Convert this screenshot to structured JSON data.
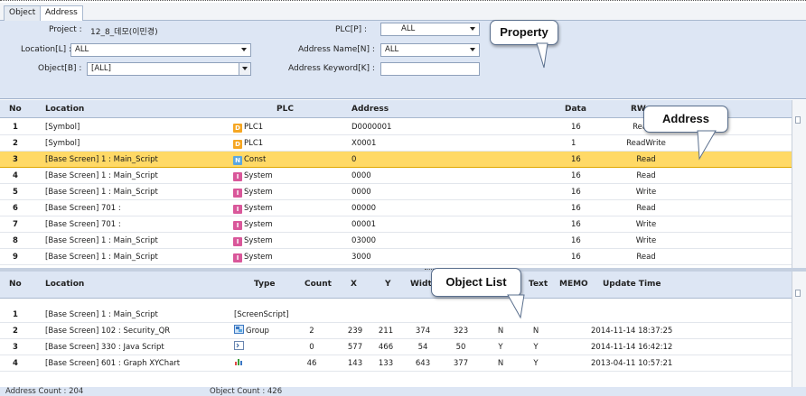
{
  "tabs": [
    "Object",
    "Address"
  ],
  "property": {
    "project_label": "Project :",
    "project_value": "12_8_데모(이민경)",
    "location_label": "Location[L] :",
    "location_value": "ALL",
    "object_label": "Object[B] :",
    "object_value": "[ALL]",
    "plc_label": "PLC[P] :",
    "plc_value": "ALL",
    "address_name_label": "Address Name[N] :",
    "address_name_value": "ALL",
    "address_keyword_label": "Address Keyword[K] :",
    "address_keyword_value": ""
  },
  "address_table": {
    "columns": [
      "No",
      "Location",
      "PLC",
      "Address",
      "Data",
      "RW"
    ],
    "rows": [
      {
        "no": "1",
        "location": "[Symbol]",
        "plc_icon": "D",
        "plc_color": "#f5a623",
        "plc": "PLC1",
        "address": "D0000001",
        "data": "16",
        "rw": "ReadW"
      },
      {
        "no": "2",
        "location": "[Symbol]",
        "plc_icon": "D",
        "plc_color": "#f5a623",
        "plc": "PLC1",
        "address": "X0001",
        "data": "1",
        "rw": "ReadWrite"
      },
      {
        "no": "3",
        "location": "[Base Screen] 1 : Main_Script",
        "plc_icon": "N",
        "plc_color": "#5aa7e0",
        "plc": "Const",
        "address": "0",
        "data": "16",
        "rw": "Read"
      },
      {
        "no": "4",
        "location": "[Base Screen] 1 : Main_Script",
        "plc_icon": "I",
        "plc_color": "#d9579a",
        "plc": "System",
        "address": "0000",
        "data": "16",
        "rw": "Read"
      },
      {
        "no": "5",
        "location": "[Base Screen] 1 : Main_Script",
        "plc_icon": "I",
        "plc_color": "#d9579a",
        "plc": "System",
        "address": "0000",
        "data": "16",
        "rw": "Write"
      },
      {
        "no": "6",
        "location": "[Base Screen] 701 :",
        "plc_icon": "I",
        "plc_color": "#d9579a",
        "plc": "System",
        "address": "00000",
        "data": "16",
        "rw": "Read"
      },
      {
        "no": "7",
        "location": "[Base Screen] 701 :",
        "plc_icon": "I",
        "plc_color": "#d9579a",
        "plc": "System",
        "address": "00001",
        "data": "16",
        "rw": "Write"
      },
      {
        "no": "8",
        "location": "[Base Screen] 1 : Main_Script",
        "plc_icon": "I",
        "plc_color": "#d9579a",
        "plc": "System",
        "address": "03000",
        "data": "16",
        "rw": "Write"
      },
      {
        "no": "9",
        "location": "[Base Screen] 1 : Main_Script",
        "plc_icon": "I",
        "plc_color": "#d9579a",
        "plc": "System",
        "address": "3000",
        "data": "16",
        "rw": "Read"
      }
    ]
  },
  "object_table": {
    "columns": [
      "No",
      "Location",
      "Type",
      "Count",
      "X",
      "Y",
      "Widt",
      "",
      "",
      "Text",
      "MEMO",
      "Update Time"
    ],
    "rows": [
      {
        "no": "1",
        "location": "[Base Screen] 1 : Main_Script",
        "type": "[ScreenScript]",
        "type_icon": "",
        "count": "",
        "x": "",
        "y": "",
        "w": "",
        "h": "",
        "c1": "",
        "text": "",
        "memo": "",
        "time": ""
      },
      {
        "no": "2",
        "location": "[Base Screen] 102 : Security_QR",
        "type": "Group",
        "type_icon": "group-icon",
        "count": "2",
        "x": "239",
        "y": "211",
        "w": "374",
        "h": "323",
        "c1": "N",
        "text": "N",
        "memo": "",
        "time": "2014-11-14 18:37:25"
      },
      {
        "no": "3",
        "location": "[Base Screen] 330 : Java Script",
        "type": "",
        "type_icon": "script-icon",
        "count": "0",
        "x": "577",
        "y": "466",
        "w": "54",
        "h": "50",
        "c1": "Y",
        "text": "Y",
        "memo": "",
        "time": "2014-11-14 16:42:12"
      },
      {
        "no": "4",
        "location": "[Base Screen] 601 : Graph XYChart",
        "type": "",
        "type_icon": "chart-icon",
        "count": "46",
        "x": "143",
        "y": "133",
        "w": "643",
        "h": "377",
        "c1": "N",
        "text": "Y",
        "memo": "",
        "time": "2013-04-11 10:57:21"
      }
    ]
  },
  "status": {
    "address_count": "Address Count : 204",
    "object_count": "Object Count : 426"
  },
  "callouts": {
    "property": "Property",
    "address": "Address",
    "object_list": "Object List"
  },
  "colors": {
    "panel": "#dde6f4",
    "selected_row": "#ffd966"
  }
}
